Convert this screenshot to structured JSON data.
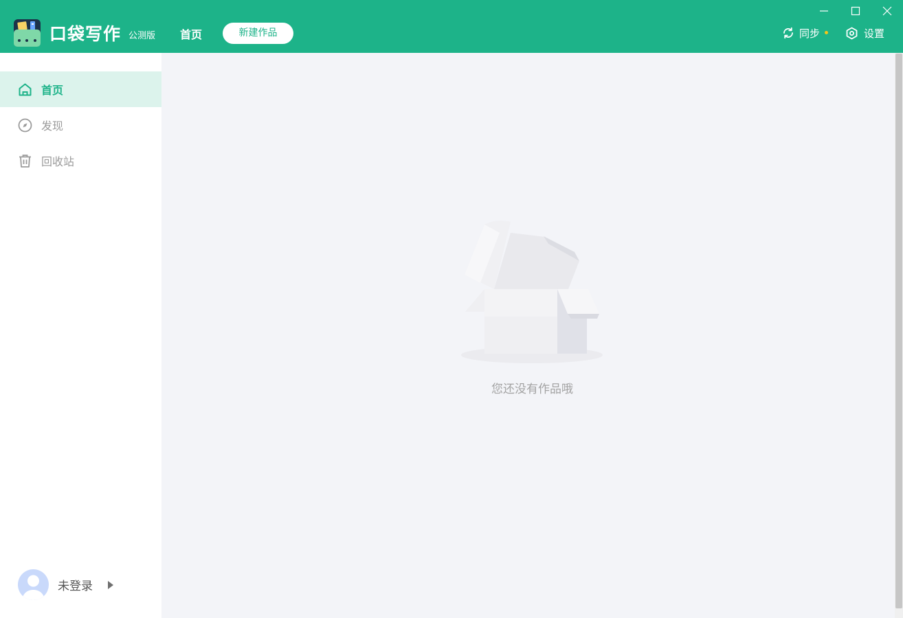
{
  "titlebar": {
    "app_name": "口袋写作",
    "edition": "公测版",
    "nav_home": "首页",
    "new_work_button": "新建作品",
    "sync_label": "同步",
    "settings_label": "设置",
    "brand_color": "#1db389",
    "sync_dot_color": "#f5c518"
  },
  "sidebar": {
    "items": [
      {
        "label": "首页",
        "icon": "home-icon",
        "active": true
      },
      {
        "label": "发现",
        "icon": "compass-icon",
        "active": false
      },
      {
        "label": "回收站",
        "icon": "trash-icon",
        "active": false
      }
    ],
    "user": {
      "name": "未登录",
      "icon": "avatar-icon"
    }
  },
  "main": {
    "empty_text": "您还没有作品哦",
    "empty_icon": "empty-box-icon"
  }
}
